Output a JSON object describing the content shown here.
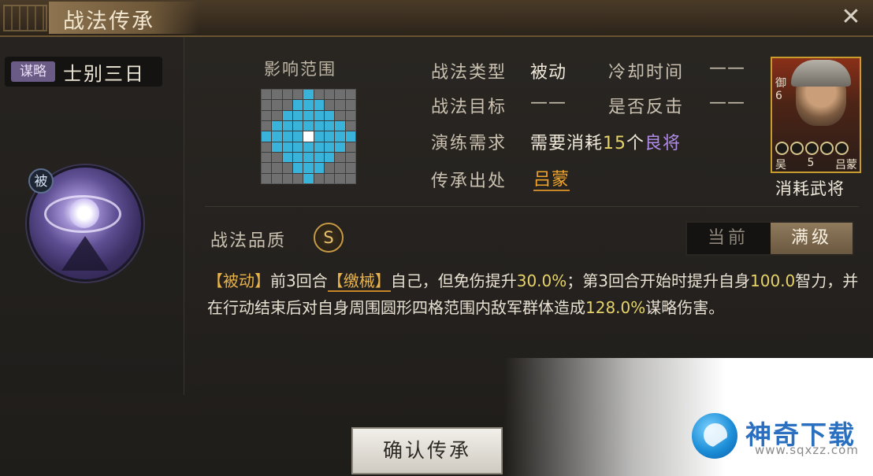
{
  "window": {
    "title": "战法传承",
    "close_icon": "close-icon"
  },
  "skill": {
    "type_badge": "谋略",
    "name": "士别三日",
    "passive_badge": "被",
    "icon": "eye-skill-icon"
  },
  "range": {
    "title": "影响范围",
    "grid_size": 9
  },
  "details": {
    "type_label": "战法类型",
    "type_value": "被动",
    "cooldown_label": "冷却时间",
    "cooldown_value": "——",
    "target_label": "战法目标",
    "target_value": "——",
    "counter_label": "是否反击",
    "counter_value": "——",
    "drill_label": "演练需求",
    "drill_prefix": "需要消耗",
    "drill_count": "15",
    "drill_unit": "个",
    "drill_grade": "良将",
    "source_label": "传承出处",
    "source_value": "吕蒙"
  },
  "hero_card": {
    "side_text": "御6",
    "faction": "吴",
    "cost": "5",
    "name": "吕蒙",
    "stars": 5,
    "consume_label": "消耗武将"
  },
  "quality": {
    "label": "战法品质",
    "grade": "S"
  },
  "level_toggle": {
    "current_label": "当前",
    "max_label": "满级",
    "selected": "满级"
  },
  "description": {
    "tag": "【被动】",
    "p1": "前3回合",
    "status": "【缴械】",
    "p2": "自己，但免伤提升",
    "v1": "30.0%",
    "p3": "；第3回合开始时提升自身",
    "v2": "100.0",
    "p4": "智力，并在行动结束后对自身周围圆形四格范围内敌军群体造成",
    "v3": "128.0%",
    "p5": "谋略伤害。"
  },
  "confirm_button": "确认传承",
  "watermark": {
    "name": "神奇下载",
    "url": "www.sqxzz.com"
  },
  "colors": {
    "accent_gold": "#c69a45",
    "range_cell_on": "#39b3d9",
    "purple_grade": "#b08be8",
    "orange_link": "#f1a52c"
  }
}
